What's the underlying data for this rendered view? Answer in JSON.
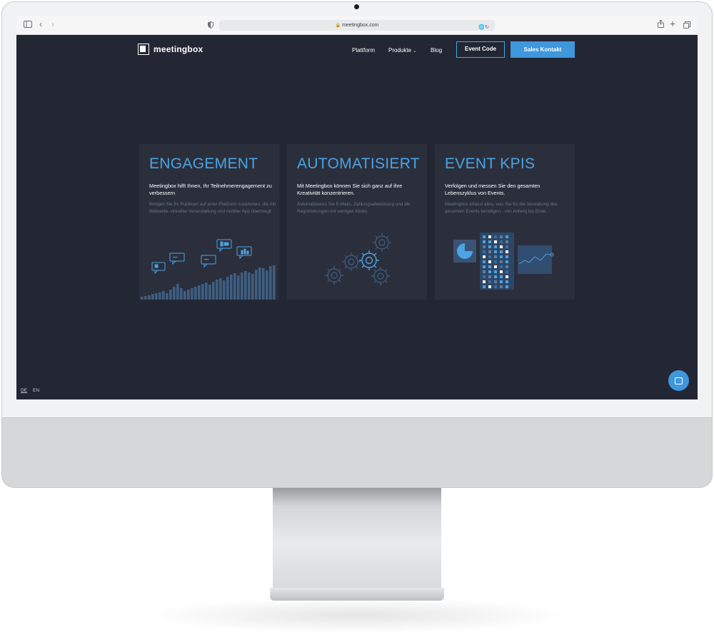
{
  "browser": {
    "url": "meetingbox.com",
    "icons": [
      "sidebar-icon",
      "back-icon",
      "forward-icon",
      "shield-icon",
      "lock-icon",
      "translate-icon",
      "reload-icon",
      "share-icon",
      "new-tab-icon",
      "tabs-icon"
    ]
  },
  "site": {
    "logo": "meetingbox",
    "nav": {
      "platform": "Plattform",
      "products": "Produkte",
      "blog": "Blog",
      "event_code": "Event Code",
      "sales": "Sales Kontakt"
    },
    "cards": [
      {
        "title": "ENGAGEMENT",
        "lead": "Meetingbox hilft Ihnen, Ihr Teilnehmerengagement zu verbessern",
        "sub": "Bringen Sie Ihr Publikum auf einer Plattform zusammen, die mit Webseite, virtueller Veranstaltung und mobiler App überzeugt."
      },
      {
        "title": "AUTOMATISIERT",
        "lead": "Mit Meetingbox können Sie sich ganz auf ihre Kreativität konzentrieren.",
        "sub": "Automatisieren Sie E-Mails, Zahlungsabwicklung und die Registrierungen mit wenigen Klicks."
      },
      {
        "title": "EVENT KPIS",
        "lead": "Verfolgen und messen Sie den gesamten Lebenszyklus von Events.",
        "sub": "Meetingbox erfasst alles, was Sie für die Verwaltung des gesamten Events benötigen - von Anfang bis Ende."
      }
    ],
    "langs": {
      "de": "DE",
      "en": "EN"
    }
  },
  "colors": {
    "background": "#232734",
    "card": "#2b2f3c",
    "accent": "#4ba3e3",
    "button": "#3f97dc"
  }
}
